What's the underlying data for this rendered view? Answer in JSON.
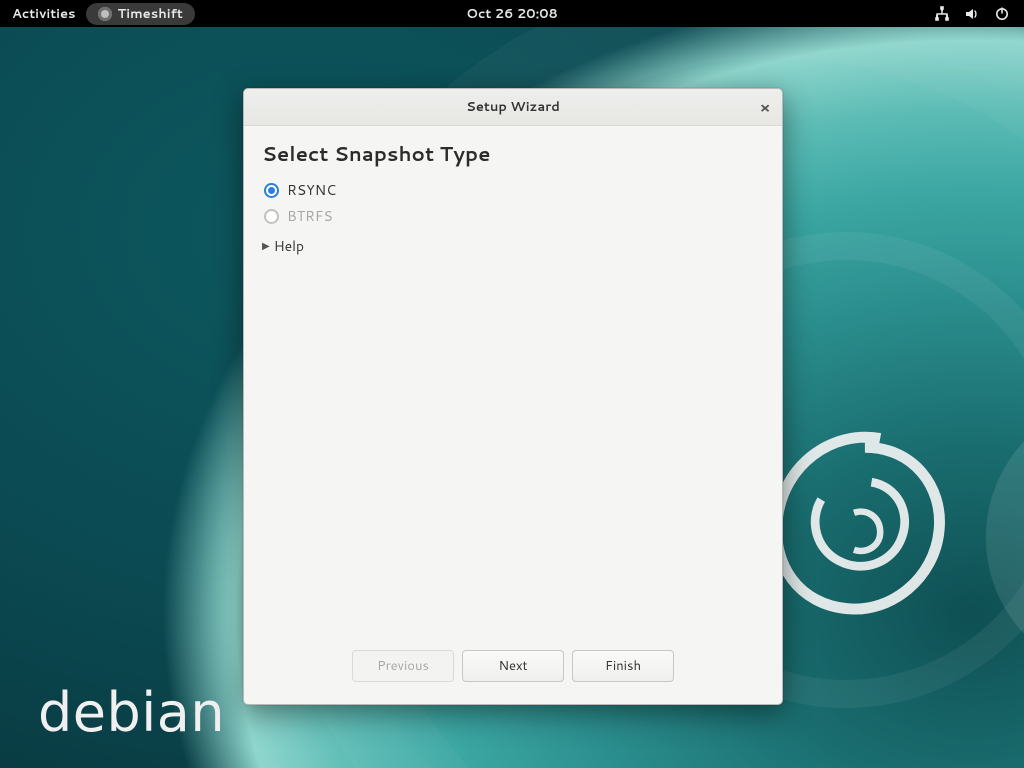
{
  "topbar": {
    "activities": "Activities",
    "app_name": "Timeshift",
    "clock": "Oct 26  20:08"
  },
  "branding": {
    "distro_wordmark": "debian"
  },
  "dialog": {
    "title": "Setup Wizard",
    "heading": "Select Snapshot Type",
    "options": {
      "rsync": "RSYNC",
      "btrfs": "BTRFS"
    },
    "selected": "rsync",
    "btrfs_enabled": false,
    "help_label": "Help",
    "buttons": {
      "previous": "Previous",
      "next": "Next",
      "finish": "Finish"
    },
    "previous_enabled": false
  }
}
